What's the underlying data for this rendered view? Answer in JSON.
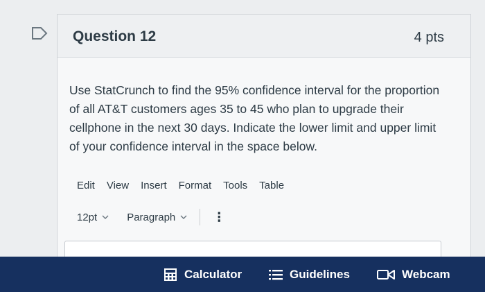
{
  "question": {
    "title": "Question 12",
    "points": "4 pts",
    "text": "Use StatCrunch to find the 95% confidence interval for the proportion of all AT&T customers ages 35 to 45 who plan to upgrade their cellphone in the next 30 days. Indicate the lower limit and upper limit of your confidence interval in the space below."
  },
  "editor": {
    "menu": [
      "Edit",
      "View",
      "Insert",
      "Format",
      "Tools",
      "Table"
    ],
    "font_size": "12pt",
    "block_format": "Paragraph"
  },
  "bottom_bar": {
    "calculator": "Calculator",
    "guidelines": "Guidelines",
    "webcam": "Webcam"
  },
  "icons": {
    "flag": "flag-outline-icon",
    "chevron": "chevron-down-icon",
    "more": "vertical-dots-icon",
    "calculator": "calculator-icon",
    "guidelines": "list-icon",
    "webcam": "video-camera-icon"
  },
  "colors": {
    "bottom_bar": "#16305f",
    "text": "#2d3b45"
  }
}
